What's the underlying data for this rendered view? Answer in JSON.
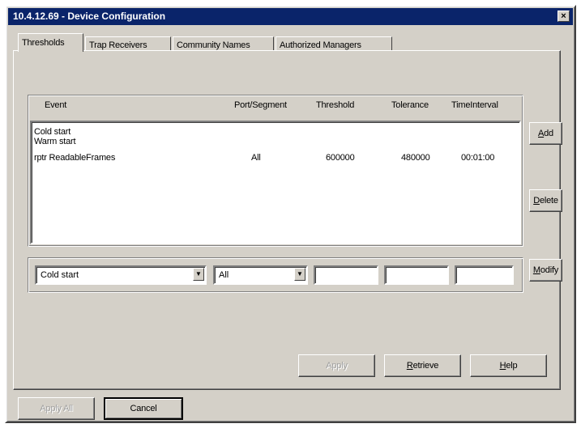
{
  "window": {
    "title": "10.4.12.69 - Device Configuration",
    "close_glyph": "×"
  },
  "tabs": [
    {
      "label": "Thresholds",
      "active": true
    },
    {
      "label": "Trap Receivers",
      "active": false
    },
    {
      "label": "Community Names",
      "active": false
    },
    {
      "label": "Authorized Managers",
      "active": false
    }
  ],
  "table": {
    "columns": [
      "Event",
      "Port/Segment",
      "Threshold",
      "Tolerance",
      "TimeInterval"
    ],
    "rows": [
      {
        "event": "Cold start",
        "port": "",
        "threshold": "",
        "tolerance": "",
        "interval": ""
      },
      {
        "event": "Warm start",
        "port": "",
        "threshold": "",
        "tolerance": "",
        "interval": ""
      },
      {
        "event": "rptr ReadableFrames",
        "port": "All",
        "threshold": "600000",
        "tolerance": "480000",
        "interval": "00:01:00"
      }
    ]
  },
  "editor": {
    "event_value": "Cold start",
    "port_value": "All",
    "threshold_value": "",
    "tolerance_value": "",
    "interval_value": ""
  },
  "buttons": {
    "add": {
      "pre": "",
      "accel": "A",
      "post": "dd"
    },
    "delete": {
      "pre": "",
      "accel": "D",
      "post": "elete"
    },
    "modify": {
      "pre": "",
      "accel": "M",
      "post": "odify"
    },
    "apply": "Apply",
    "retrieve": {
      "pre": "",
      "accel": "R",
      "post": "etrieve"
    },
    "help": {
      "pre": "",
      "accel": "H",
      "post": "elp"
    },
    "apply_all": "Apply All",
    "cancel": "Cancel"
  }
}
